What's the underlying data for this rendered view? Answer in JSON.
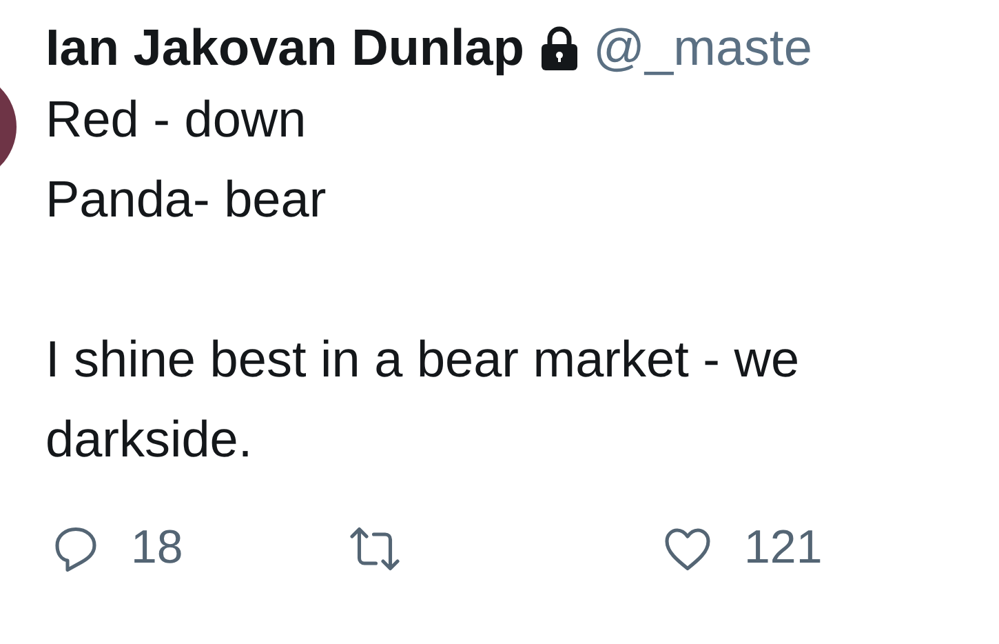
{
  "author": {
    "name": "Ian Jakovan Dunlap",
    "protected": true,
    "handle": "@_maste"
  },
  "text": "Red - down\nPanda- bear\n\nI shine best in a bear market - we\ndarkside.",
  "actions": [
    {
      "kind": "reply",
      "count": "18"
    },
    {
      "kind": "retweet"
    },
    {
      "kind": "like",
      "count": "121"
    }
  ]
}
